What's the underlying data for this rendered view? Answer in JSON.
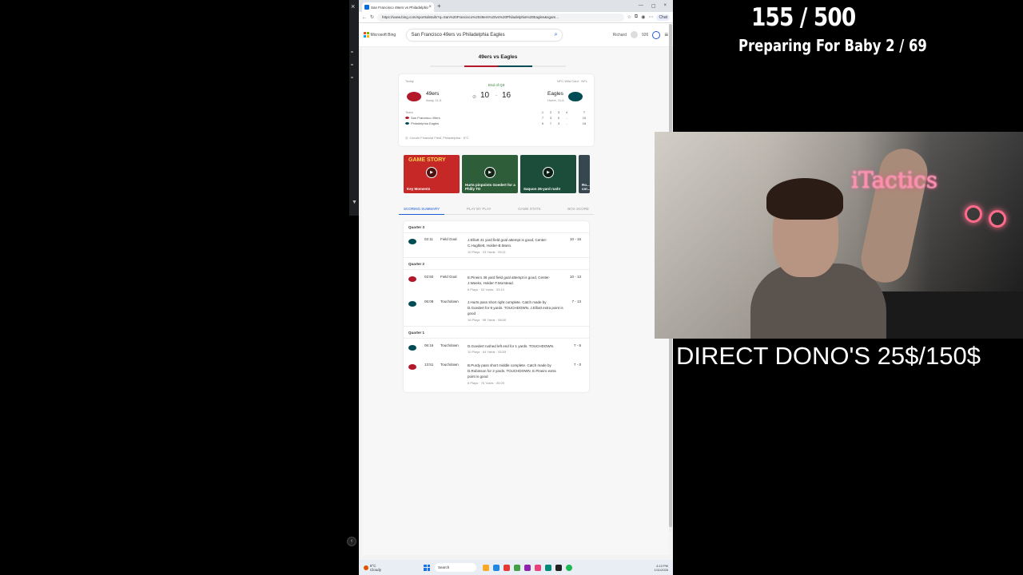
{
  "left_window": {
    "close_glyph": "×",
    "collapse_glyph": "▼",
    "back_glyph": "‹"
  },
  "browser": {
    "tab": {
      "title": "San Francisco 49ers vs Philadelphia",
      "close": "×",
      "new_tab": "+"
    },
    "window_controls": [
      "—",
      "▢",
      "×"
    ],
    "url": "https://www.bing.com/sportsdetails?q=San%20Francisco%2049ers%20vs%20Philadelphia%20Eagles&sgam...",
    "copilot_label": "Chat",
    "header": {
      "brand": "Microsoft Bing",
      "search_value": "San Francisco 49ers vs Philadelphia Eagles",
      "user": "Richard",
      "points": "926"
    }
  },
  "game": {
    "title": "49ers vs Eagles",
    "date": "Today",
    "status": "End of Q3",
    "round": "NFC Wild Card · NFL",
    "away": {
      "name": "49ers",
      "record": "Away, 11-6",
      "score": "10",
      "color": "#b3182a"
    },
    "home": {
      "name": "Eagles",
      "record": "Home, 11-6",
      "score": "16",
      "color": "#004c54"
    },
    "score_sep": "-",
    "linescore": {
      "header_label": "Team",
      "periods": [
        "1",
        "2",
        "3",
        "4",
        "T"
      ],
      "rows": [
        {
          "team": "San Francisco 49ers",
          "vals": [
            "7",
            "3",
            "0",
            "-",
            "10"
          ]
        },
        {
          "team": "Philadelphia Eagles",
          "vals": [
            "6",
            "7",
            "3",
            "-",
            "16"
          ]
        }
      ]
    },
    "venue": "Lincoln Financial Field, Philadelphia · 8°C"
  },
  "videos": [
    {
      "title": "GAME STORY",
      "caption": "Key Moments",
      "bg": "#c62828"
    },
    {
      "title": "",
      "caption": "Hurts pinpoints Goedert for a Philly TD",
      "bg": "#2e5d3a"
    },
    {
      "title": "",
      "caption": "Saquon 26-yard rush!",
      "bg": "#1b4d3a"
    },
    {
      "title": "",
      "caption": "Ro... cor...",
      "bg": "#37474f"
    }
  ],
  "tabs": [
    "SCORING SUMMARY",
    "PLAY BY PLAY",
    "GAME STATS",
    "BOX SCORE"
  ],
  "summary": {
    "quarters": [
      {
        "label": "Quarter 3",
        "plays": [
          {
            "team": "eagles",
            "time": "02:11",
            "type": "Field Goal",
            "desc": "J.Elliott 41 yard field goal attempt is good, Center-C.Hughlett, Holder-B.Mann.",
            "meta": "10 Plays · 23 Yards · 05:11",
            "score": "10 - 16"
          }
        ]
      },
      {
        "label": "Quarter 2",
        "plays": [
          {
            "team": "49ers",
            "time": "02:50",
            "type": "Field Goal",
            "desc": "E.Pineiro 36 yard field goal attempt is good, Center-J.Weeks, Holder-T.Morstead.",
            "meta": "6 Plays · 53 Yards · 03:10",
            "score": "10 - 13"
          },
          {
            "team": "eagles",
            "time": "06:08",
            "type": "Touchdown",
            "desc": "J.Hurts pass short right complete. Catch made by D.Goedert for 9 yards. TOUCHDOWN. J.Elliott extra point is good",
            "meta": "16 Plays · 98 Yards · 08:00",
            "score": "7 - 13"
          }
        ]
      },
      {
        "label": "Quarter 1",
        "plays": [
          {
            "team": "eagles",
            "time": "06:16",
            "type": "Touchdown",
            "desc": "D.Goedert rushed left end for 1 yards. TOUCHDOWN.",
            "meta": "10 Plays · 64 Yards · 05:53",
            "score": "7 - 6"
          },
          {
            "team": "49ers",
            "time": "13:51",
            "type": "Touchdown",
            "desc": "B.Purdy pass short middle complete. Catch made by D.Robinson for 2 yards. TOUCHDOWN. E.Pineiro extra point is good",
            "meta": "6 Plays · 76 Yards · 05:09",
            "score": "7 - 0"
          }
        ]
      }
    ]
  },
  "taskbar": {
    "weather_temp": "8°C",
    "weather_text": "Cloudy",
    "search_placeholder": "Search",
    "time": "4:13 PM",
    "date": "1/11/2026"
  },
  "overlay": {
    "counter": "155 / 500",
    "goal": "Preparing For Baby  2 / 69",
    "webcam_brand": "iTactics",
    "dono": "DIRECT DONO'S 25$/150$"
  }
}
